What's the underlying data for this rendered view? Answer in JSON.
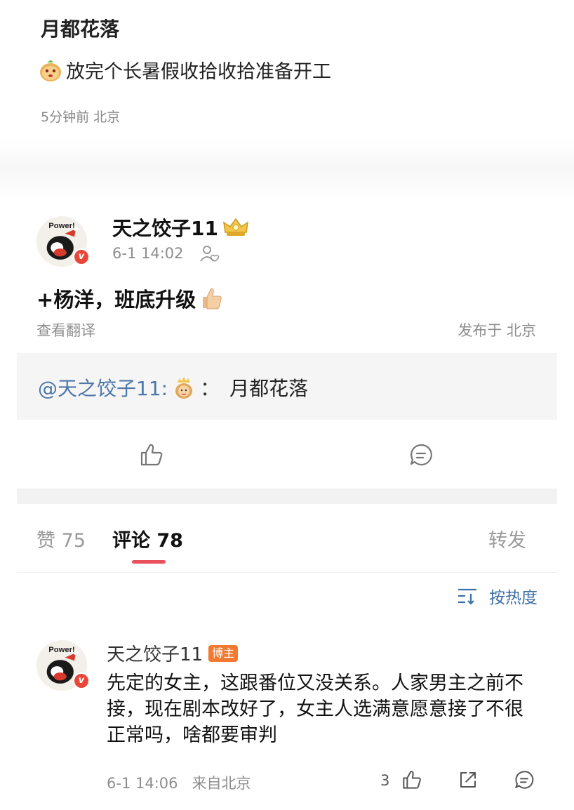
{
  "top_card": {
    "name": "月都花落",
    "text": "放完个长暑假收拾收拾准备开工",
    "meta": "5分钟前  北京"
  },
  "post": {
    "name": "天之饺子11",
    "time": "6-1 14:02",
    "body": "+杨洋，班底升级",
    "translate": "查看翻译",
    "location": "发布于 北京",
    "avatar_text": "Power!",
    "repost": {
      "user": "@天之饺子11:",
      "sep": "：",
      "text": "月都花落"
    }
  },
  "tabs": {
    "likes": "赞 75",
    "comments": "评论 78",
    "reposts": "转发"
  },
  "sort": {
    "label": "按热度"
  },
  "comment": {
    "name": "天之饺子11",
    "badge": "博主",
    "avatar_text": "Power!",
    "text": "先定的女主，这跟番位又没关系。人家男主之前不接，现在剧本改好了，女主人选满意愿意接了不很正常吗，啥都要审判",
    "meta": "6-1 14:06   来自北京",
    "like_count": "3"
  },
  "colors": {
    "link_blue": "#4d77a8",
    "tab_accent": "#e8505b",
    "badge_orange": "#f27a30",
    "verified_red": "#e8473a"
  },
  "icons": [
    "dumpling-emoji",
    "crown-icon",
    "follow-user-icon",
    "thumbs-up-emoji",
    "queen-emoji",
    "like-icon",
    "comment-icon",
    "sort-icon",
    "share-icon"
  ]
}
